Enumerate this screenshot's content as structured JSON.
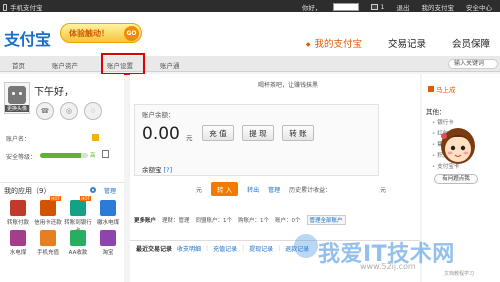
{
  "topbar": {
    "left_text": "手机支付宝",
    "greeting": "你好，",
    "mail_count": "1",
    "links": [
      "退出",
      "我的支付宝",
      "安全中心"
    ]
  },
  "header": {
    "logo": "支付宝",
    "slogan": "体验触动！",
    "slogan_go": "GO",
    "nav": [
      "我的支付宝",
      "交易记录",
      "会员保障"
    ]
  },
  "subnav": {
    "items": [
      "首页",
      "账户资产",
      "账户设置",
      "账户通"
    ],
    "search_placeholder": "输入关键词"
  },
  "profile": {
    "greeting": "下午好，",
    "avatar_label": "更换头像",
    "account_label": "账户名：",
    "security_label": "安全等级：",
    "security_level": "高",
    "security_progress": 0.85
  },
  "apps": {
    "title": "我的应用（9）",
    "manage": "管理",
    "items": [
      {
        "label": "转账付款",
        "color": "#c0392b"
      },
      {
        "label": "信用卡还款",
        "color": "#d35400",
        "hot": "HOT"
      },
      {
        "label": "转账到银行卡",
        "color": "#16a085",
        "hot": "HOT"
      },
      {
        "label": "缴水电煤",
        "color": "#2c7bd6"
      },
      {
        "label": "水电煤",
        "color": "#a43d8a"
      },
      {
        "label": "手机充值",
        "color": "#e67e22"
      },
      {
        "label": "AA收款",
        "color": "#27ae60"
      },
      {
        "label": "淘宝",
        "color": "#8e44ad"
      }
    ]
  },
  "main": {
    "news": "喝杯茶吧，让赚钱抹黑",
    "balance_label": "账户余额：",
    "balance": "0.00",
    "unit": "元",
    "buttons": [
      "充 值",
      "提 现",
      "转 账"
    ],
    "yuebao_label": "余额宝",
    "yuebao_q": "[?]",
    "yuebao_unit": "元",
    "yuebao_in": "转 入",
    "yuebao_out": "转出",
    "yuebao_manage": "管理",
    "yuebao_history": "历史累计收益：",
    "yuebao_history_unit": "元",
    "more_accounts": {
      "label": "更多账户",
      "items": [
        "理财：管理",
        "同盟账户：1个",
        "购账户：1个",
        "账户：0个"
      ],
      "manage_all": "管理全部账户"
    },
    "recent": {
      "title": "最近交易记录",
      "links": [
        "收支明细",
        "充值记录",
        "提现记录",
        "退款记录"
      ]
    }
  },
  "right": {
    "promo": "马上成",
    "others_title": "其他：",
    "items": [
      "银行卡",
      "红包",
      "集分宝",
      "积分",
      "支付宝卡"
    ],
    "help_button": "有问题点我"
  },
  "watermark": {
    "text": "我爱IT技术网",
    "url": "www.52ij.com",
    "small": "文档教程学习"
  }
}
